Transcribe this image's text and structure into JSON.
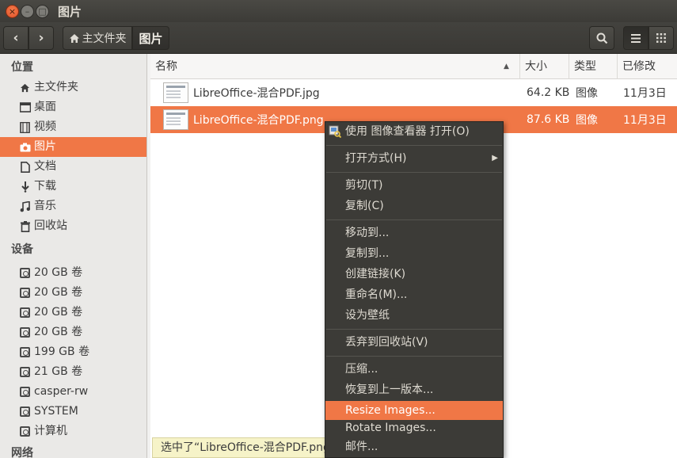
{
  "window": {
    "title": "图片",
    "close_glyph": "×",
    "min_glyph": "–",
    "max_glyph": "□"
  },
  "toolbar": {
    "back_glyph": "‹",
    "forward_glyph": "›",
    "breadcrumb_home": "主文件夹",
    "breadcrumb_current": "图片"
  },
  "sidebar": {
    "section_places": "位置",
    "places": [
      {
        "label": "主文件夹",
        "icon": "home-icon"
      },
      {
        "label": "桌面",
        "icon": "desktop-icon"
      },
      {
        "label": "视频",
        "icon": "video-icon"
      },
      {
        "label": "图片",
        "icon": "camera-icon",
        "selected": true
      },
      {
        "label": "文档",
        "icon": "document-icon"
      },
      {
        "label": "下载",
        "icon": "download-icon"
      },
      {
        "label": "音乐",
        "icon": "music-icon"
      },
      {
        "label": "回收站",
        "icon": "trash-icon"
      }
    ],
    "section_devices": "设备",
    "devices": [
      "20 GB 卷",
      "20 GB 卷",
      "20 GB 卷",
      "20 GB 卷",
      "199 GB 卷",
      "21 GB 卷",
      "casper-rw",
      "SYSTEM",
      "计算机"
    ],
    "section_network": "网络"
  },
  "columns": {
    "name": "名称",
    "size": "大小",
    "type": "类型",
    "modified": "已修改"
  },
  "files": [
    {
      "name": "LibreOffice-混合PDF.jpg",
      "size": "64.2 KB",
      "type": "图像",
      "modified": "11月3日",
      "selected": false
    },
    {
      "name": "LibreOffice-混合PDF.png",
      "size": "87.6 KB",
      "type": "图像",
      "modified": "11月3日",
      "selected": true
    }
  ],
  "status": "选中了“LibreOffice-混合PDF.png”",
  "context_menu": {
    "items": [
      {
        "label": "使用 图像查看器 打开(O)",
        "icon": "image-viewer-icon"
      },
      {
        "label": "打开方式(H)",
        "submenu": true
      },
      {
        "label": "剪切(T)"
      },
      {
        "label": "复制(C)"
      },
      {
        "label": "移动到..."
      },
      {
        "label": "复制到..."
      },
      {
        "label": "创建链接(K)"
      },
      {
        "label": "重命名(M)..."
      },
      {
        "label": "设为壁纸"
      },
      {
        "label": "丢弃到回收站(V)"
      },
      {
        "label": "压缩..."
      },
      {
        "label": "恢复到上一版本..."
      },
      {
        "label": "Resize Images...",
        "highlighted": true
      },
      {
        "label": "Rotate Images..."
      },
      {
        "label": "邮件..."
      }
    ]
  },
  "colors": {
    "accent": "#f07746",
    "menu_bg": "#3c3b37",
    "titlebar": "#3c3b37"
  }
}
